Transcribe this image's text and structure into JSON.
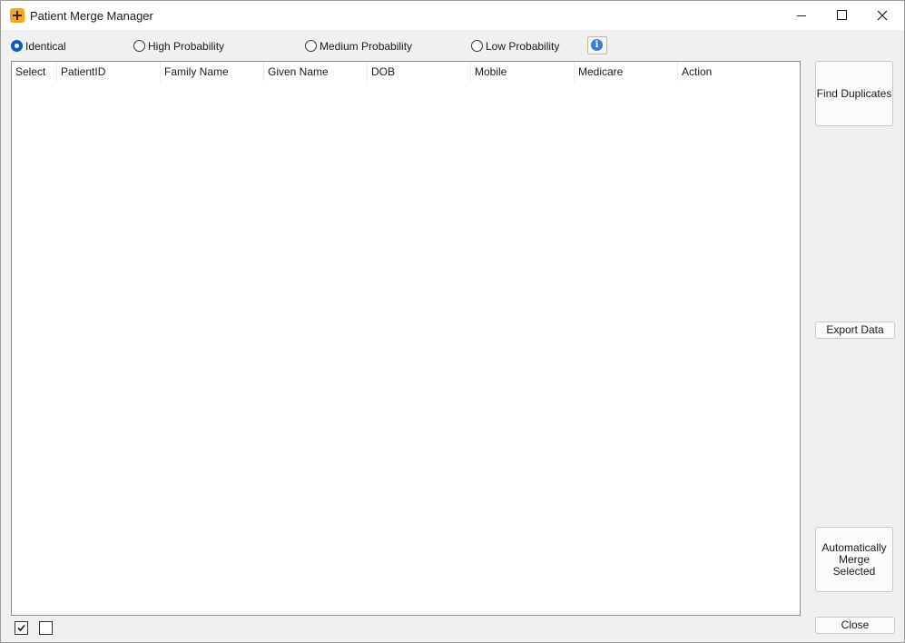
{
  "window": {
    "title": "Patient Merge Manager"
  },
  "filters": {
    "options": [
      {
        "label": "Identical",
        "checked": true
      },
      {
        "label": "High Probability",
        "checked": false
      },
      {
        "label": "Medium Probability",
        "checked": false
      },
      {
        "label": "Low Probability",
        "checked": false
      }
    ]
  },
  "grid": {
    "columns": [
      "Select",
      "PatientID",
      "Family Name",
      "Given Name",
      "DOB",
      "Mobile",
      "Medicare",
      "Action"
    ],
    "rows": []
  },
  "buttons": {
    "find_duplicates": "Find Duplicates",
    "export_data": "Export Data",
    "auto_merge": "Automatically Merge Selected",
    "close": "Close"
  },
  "icons": {
    "app": "patient-merge-app-icon",
    "info": "info-icon",
    "select_all": "checked-checkbox-icon",
    "deselect_all": "empty-checkbox-icon"
  },
  "colors": {
    "accent": "#0a5cc4",
    "app_icon": "#f5a623",
    "window_bg": "#f0f0f0"
  }
}
